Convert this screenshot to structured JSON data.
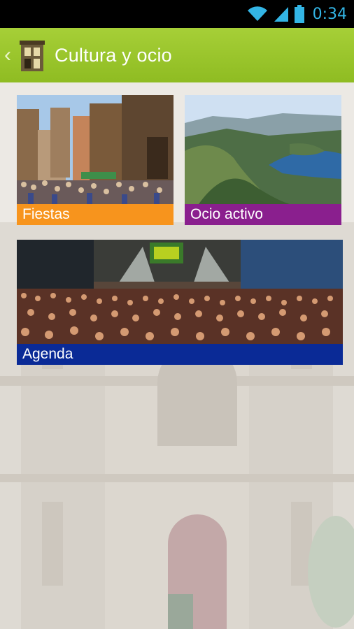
{
  "status_bar": {
    "time": "0:34",
    "icons": [
      "wifi-icon",
      "signal-icon",
      "battery-icon"
    ],
    "time_color": "#33b5e5"
  },
  "action_bar": {
    "title": "Cultura y ocio",
    "back_icon": "chevron-left-icon",
    "app_icon": "tower-icon",
    "color": "#9cc72c"
  },
  "tiles": [
    {
      "label": "Fiestas",
      "color": "#f7941d",
      "image": "street-festival-crowd-photo"
    },
    {
      "label": "Ocio activo",
      "color": "#8a1f8e",
      "image": "river-canyon-landscape-photo"
    },
    {
      "label": "Agenda",
      "color": "#0a2a96",
      "image": "concert-crowd-photo"
    }
  ],
  "background": {
    "image": "church-facade-watermark"
  }
}
